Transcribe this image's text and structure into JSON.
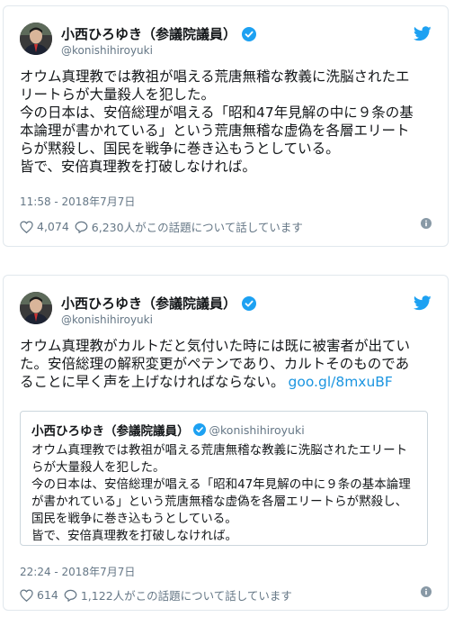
{
  "tweets": [
    {
      "display_name": "小西ひろゆき（参議院議員）",
      "handle": "@konishihiroyuki",
      "text_lines": [
        "オウム真理教では教祖が唱える荒唐無稽な教義に洗脳されたエ",
        "リートらが大量殺人を犯した。",
        "今の日本は、安倍総理が唱える「昭和47年見解の中に９条の基",
        "本論理が書かれている」という荒唐無稽な虚偽を各層エリート",
        "らが黙殺し、国民を戦争に巻き込もうとしている。",
        "皆で、安倍真理教を打破しなければ。"
      ],
      "timestamp": "11:58 - 2018年7月7日",
      "likes": "4,074",
      "replies": "6,230人がこの話題について話しています"
    },
    {
      "display_name": "小西ひろゆき（参議院議員）",
      "handle": "@konishihiroyuki",
      "text_lines": [
        "オウム真理教がカルトだと気付いた時には既に被害者が出てい",
        "た。安倍総理の解釈変更がペテンであり、カルトそのものであ",
        "ることに早く声を上げなければならない。"
      ],
      "link": "goo.gl/8mxuBF",
      "quoted": {
        "display_name": "小西ひろゆき（参議院議員）",
        "handle": "@konishihiroyuki",
        "text_lines": [
          "オウム真理教では教祖が唱える荒唐無稽な教義に洗脳されたエリート",
          "らが大量殺人を犯した。",
          "今の日本は、安倍総理が唱える「昭和47年見解の中に９条の基本論理",
          "が書かれている」という荒唐無稽な虚偽を各層エリートらが黙殺し、",
          "国民を戦争に巻き込もうとしている。",
          "皆で、安倍真理教を打破しなければ。"
        ]
      },
      "timestamp": "22:24 - 2018年7月7日",
      "likes": "614",
      "replies": "1,122人がこの話題について話しています"
    }
  ],
  "colors": {
    "accent": "#1da1f2",
    "link": "#1b95e0",
    "muted": "#657786",
    "border": "#e1e8ed"
  },
  "icons": [
    "avatar-photo",
    "verified-badge-icon",
    "twitter-bird-icon",
    "heart-icon",
    "reply-bubble-icon",
    "info-icon"
  ]
}
